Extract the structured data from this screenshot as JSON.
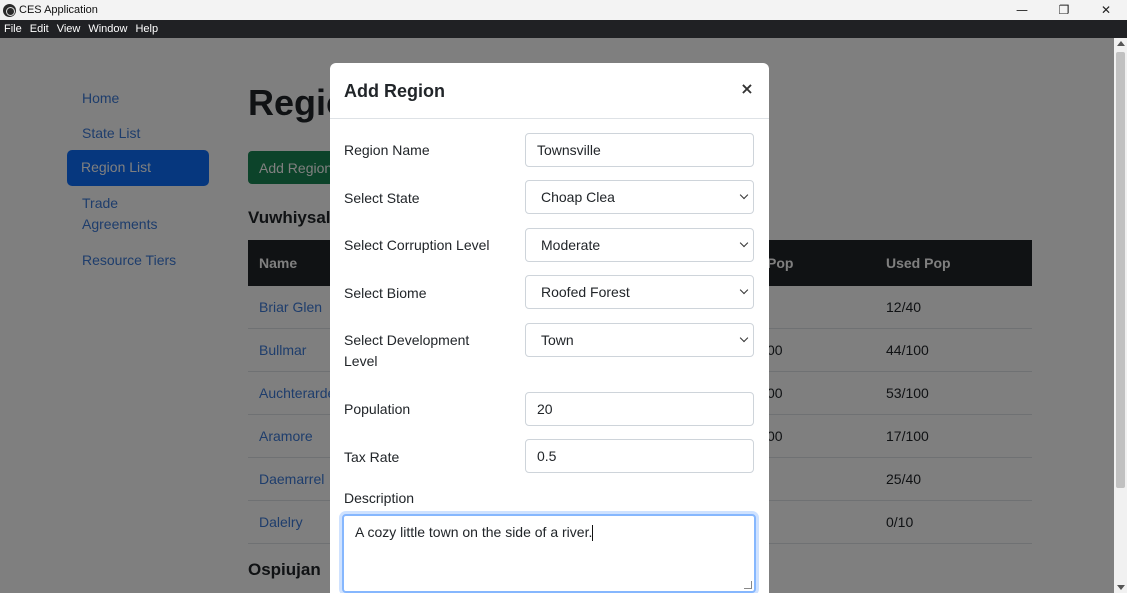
{
  "window": {
    "title": "CES Application",
    "minimize": "—",
    "restore": "❐",
    "close": "✕"
  },
  "menu": [
    "File",
    "Edit",
    "View",
    "Window",
    "Help"
  ],
  "sidebar": {
    "items": [
      {
        "label": "Home"
      },
      {
        "label": "State List"
      },
      {
        "label": "Region List"
      },
      {
        "label": "Trade"
      },
      {
        "label": "Agreements"
      },
      {
        "label": "Resource Tiers"
      }
    ]
  },
  "page": {
    "title": "Regions",
    "add_button": "Add Region",
    "groups": [
      {
        "state": "Vuwhiysal"
      },
      {
        "state": "Ospiujan"
      }
    ]
  },
  "table": {
    "headers": {
      "name": "Name",
      "pop": "Pop",
      "used_pop": "Used Pop"
    },
    "rows": [
      {
        "name": "Briar Glen",
        "pop": "",
        "used": "12/40"
      },
      {
        "name": "Bullmar",
        "pop": "00",
        "used": "44/100"
      },
      {
        "name": "Auchterarder",
        "pop": "00",
        "used": "53/100"
      },
      {
        "name": "Aramore",
        "pop": "00",
        "used": "17/100"
      },
      {
        "name": "Daemarrel",
        "pop": "",
        "used": "25/40"
      },
      {
        "name": "Dalelry",
        "pop": "",
        "used": "0/10"
      }
    ]
  },
  "modal": {
    "title": "Add Region",
    "close": "×",
    "fields": {
      "region_name": {
        "label": "Region Name",
        "value": "Townsville"
      },
      "state": {
        "label": "Select State",
        "value": "Choap Clea"
      },
      "corruption": {
        "label": "Select Corruption Level",
        "value": "Moderate"
      },
      "biome": {
        "label": "Select Biome",
        "value": "Roofed Forest"
      },
      "development": {
        "label": "Select Development Level",
        "value": "Town"
      },
      "population": {
        "label": "Population",
        "value": "20"
      },
      "tax_rate": {
        "label": "Tax Rate",
        "value": "0.5"
      },
      "description": {
        "label": "Description",
        "value": "A cozy little town on the side of a river."
      }
    }
  }
}
